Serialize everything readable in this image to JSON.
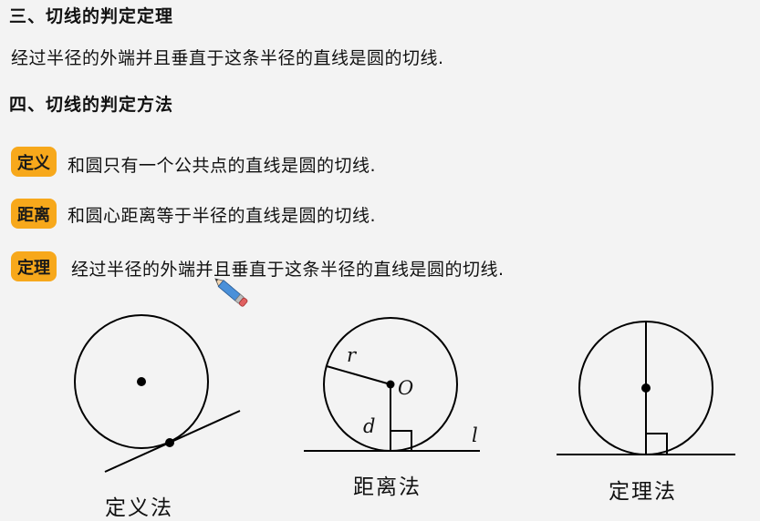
{
  "section3": {
    "heading": "三、切线的判定定理",
    "text": "经过半径的外端并且垂直于这条半径的直线是圆的切线."
  },
  "section4": {
    "heading": "四、切线的判定方法",
    "methods": [
      {
        "tag": "定义",
        "text": "和圆只有一个公共点的直线是圆的切线."
      },
      {
        "tag": "距离",
        "text": "和圆心距离等于半径的直线是圆的切线."
      },
      {
        "tag": "定理",
        "text": "经过半径的外端并且垂直于这条半径的直线是圆的切线."
      }
    ]
  },
  "figures": [
    {
      "caption": "定义法"
    },
    {
      "caption": "距离法",
      "labels": {
        "radius": "r",
        "center": "O",
        "distance": "d",
        "line": "l"
      }
    },
    {
      "caption": "定理法"
    }
  ],
  "colors": {
    "tag_bg": "#f7a81b",
    "background": "#f3f3f3"
  },
  "icons": {
    "cursor": "pencil-icon"
  }
}
